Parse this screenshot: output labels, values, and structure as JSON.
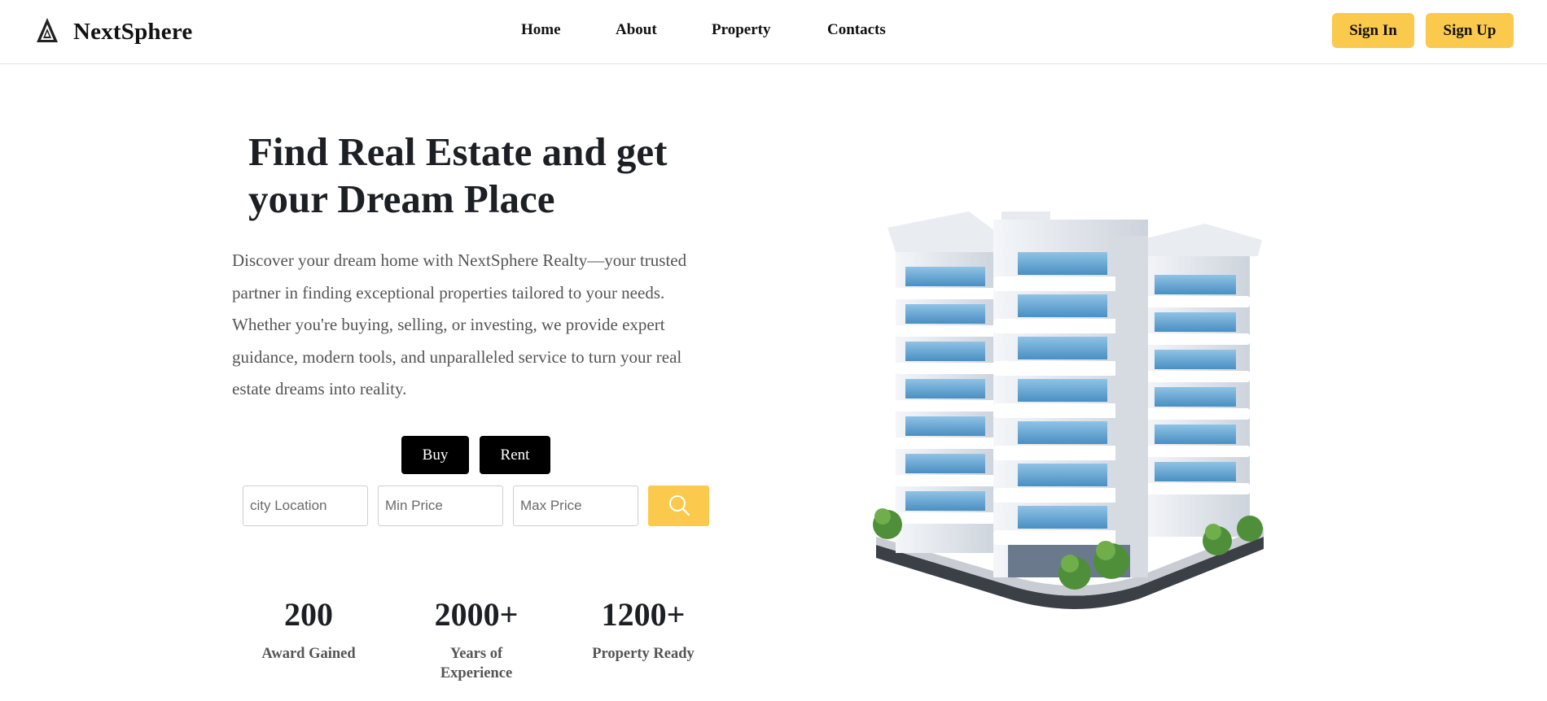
{
  "header": {
    "brand": "NextSphere",
    "logo_icon": "triangle-logo-icon",
    "nav": [
      {
        "label": "Home"
      },
      {
        "label": "About"
      },
      {
        "label": "Property"
      },
      {
        "label": "Contacts"
      }
    ],
    "sign_in": "Sign In",
    "sign_up": "Sign Up"
  },
  "hero": {
    "title_line1": "Find Real Estate and get",
    "title_line2": "your Dream Place",
    "description": "Discover your dream home with NextSphere Realty—your trusted partner in finding exceptional properties tailored to your needs. Whether you're buying, selling, or investing, we provide expert guidance, modern tools, and unparalleled service to turn your real estate dreams into reality.",
    "buy_label": "Buy",
    "rent_label": "Rent"
  },
  "search": {
    "city_placeholder": "city Location",
    "min_price_placeholder": "Min Price",
    "max_price_placeholder": "Max Price",
    "search_icon": "search-icon"
  },
  "stats": [
    {
      "value": "200",
      "label": "Award Gained"
    },
    {
      "value": "2000+",
      "label": "Years of Experience"
    },
    {
      "value": "1200+",
      "label": "Property Ready"
    }
  ],
  "colors": {
    "accent": "#fbc94c",
    "dark_button": "#000000",
    "heading": "#1c1f24",
    "body_text": "#555555"
  }
}
